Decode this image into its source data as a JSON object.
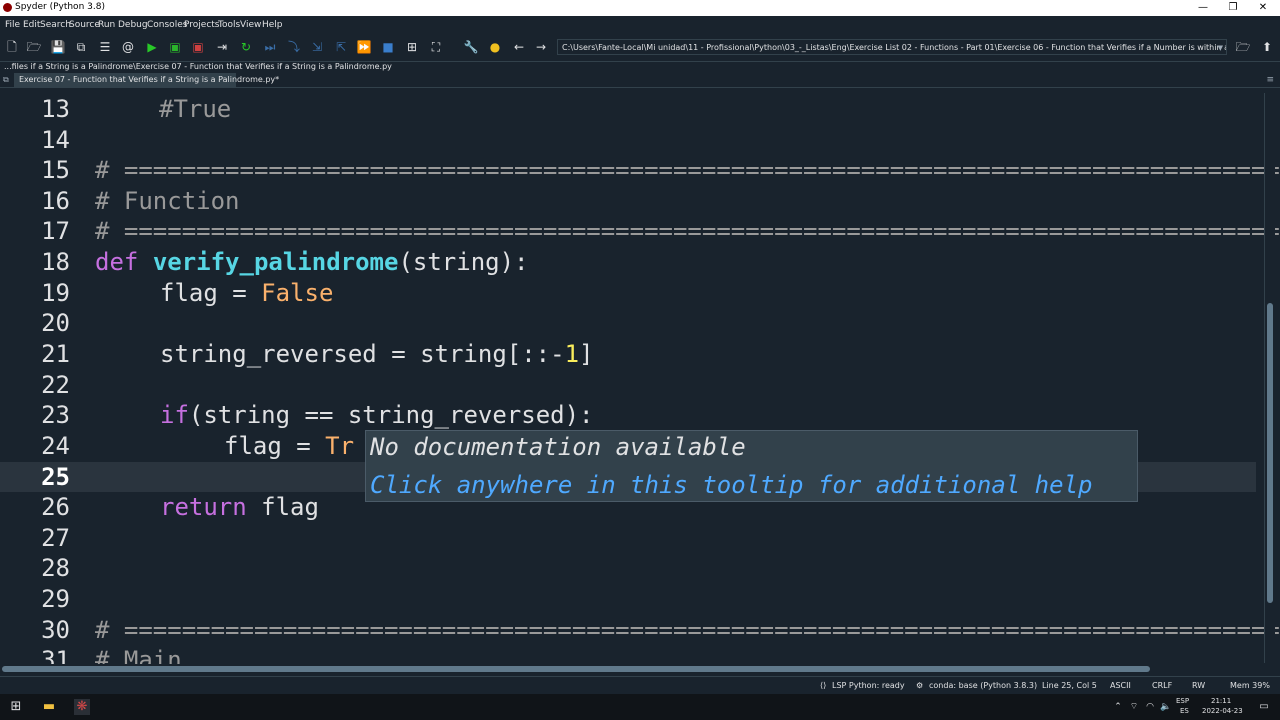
{
  "window": {
    "title": "Spyder (Python 3.8)",
    "controls": {
      "minimize": "—",
      "maximize": "❐",
      "close": "✕"
    }
  },
  "menu": [
    "File",
    "Edit",
    "Search",
    "Source",
    "Run",
    "Debug",
    "Consoles",
    "Projects",
    "Tools",
    "View",
    "Help"
  ],
  "toolbar": {
    "path": "C:\\Users\\Fante-Local\\Mi unidad\\11 - Profissional\\Python\\03_-_Listas\\Eng\\Exercise List 02 - Functions - Part 01\\Exercise 06 - Function that Verifies if a Number is within a Certain Range",
    "icons": [
      "new-file-icon",
      "open-file-icon",
      "save-icon",
      "save-all-icon",
      "create-cell-icon",
      "list-icon",
      "at-icon",
      "run-icon",
      "run-cell-icon",
      "run-cell-advance-icon",
      "run-selection-icon",
      "restart-icon",
      "debug-icon",
      "step-icon",
      "step-into-icon",
      "step-return-icon",
      "continue-icon",
      "stop-icon",
      "maximize-pane-icon",
      "fullscreen-icon",
      "preferences-icon",
      "python-path-icon",
      "back-icon",
      "forward-icon",
      "browse-folder-icon",
      "parent-folder-icon"
    ]
  },
  "editor": {
    "file_path": "...files if a String is a Palindrome\\Exercise 07 - Function that Verifies if a String is a Palindrome.py",
    "tab_label": "Exercise 07 - Function that Verifies if a String is a Palindrome.py*",
    "line_numbers": [
      "13",
      "14",
      "15",
      "16",
      "17",
      "18",
      "19",
      "20",
      "21",
      "22",
      "23",
      "24",
      "25",
      "26",
      "27",
      "28",
      "29",
      "30",
      "31"
    ],
    "code": {
      "l13_comment": "#True",
      "l15_comment": "# ==================================================================================",
      "l16_comment": "# Function",
      "l17_comment": "# ==================================================================================",
      "l18_kw": "def",
      "l18_fn": "verify_palindrome",
      "l18_rest": "(string):",
      "l19_code": "flag = ",
      "l19_val": "False",
      "l21_code": "string_reversed = string[::-",
      "l21_num": "1",
      "l21_end": "]",
      "l23_kw": "if",
      "l23_code": "(string == string_reversed):",
      "l24_code": "flag = ",
      "l24_val": "Tr",
      "l26_kw": "return",
      "l26_code": " flag",
      "l30_comment": "# ==================================================================================",
      "l31_comment": "# Main"
    },
    "current_line": "25"
  },
  "tooltip": {
    "line1": "No documentation available",
    "line2": "Click anywhere in this tooltip for additional help"
  },
  "status": {
    "lsp": "LSP Python: ready",
    "conda": "conda: base (Python 3.8.3)",
    "cursor": "Line 25, Col 5",
    "encoding": "ASCII",
    "eol": "CRLF",
    "permissions": "RW",
    "memory": "Mem 39%"
  },
  "taskbar": {
    "lang": "ESP",
    "lang_sub": "ES",
    "time": "21:11",
    "date": "2022-04-23"
  },
  "colors": {
    "background": "#19232d",
    "keyword": "#c670e0",
    "function": "#57d6e4",
    "builtin": "#fab16c",
    "number": "#faed5c",
    "tooltip_link": "#4fa9ff"
  }
}
